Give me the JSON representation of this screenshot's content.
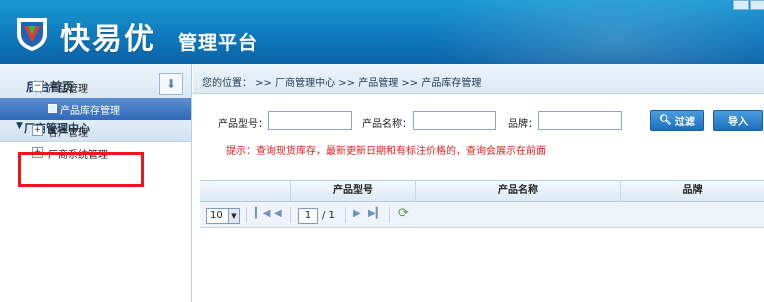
{
  "header": {
    "brand": "快易优",
    "platform": "管理平台"
  },
  "sidebar": {
    "home": "后台首页",
    "pin_icon": "pin-icon",
    "group": "厂商管理中心",
    "items": [
      {
        "label": "产品管理"
      },
      {
        "label": "产品库存管理",
        "selected": true
      },
      {
        "label": "客户管理"
      },
      {
        "label": "厂商系统管理"
      }
    ]
  },
  "breadcrumb": "您的位置： >> 厂商管理中心 >> 产品管理 >> 产品库存管理",
  "filter": {
    "model_label": "产品型号：",
    "name_label": "产品名称：",
    "brand_label": "品牌：",
    "model_value": "",
    "name_value": "",
    "brand_value": "",
    "filter_button": "过滤",
    "import_button": "导入",
    "tip": "提示：查询现货库存，最新更新日期和有标注价格的，查询会展示在前面"
  },
  "grid": {
    "columns": [
      "产品型号",
      "产品名称",
      "品牌"
    ]
  },
  "pager": {
    "page_size": "10",
    "current_page": "1",
    "total": "/ 1"
  },
  "colors": {
    "header": "#0e79bd",
    "highlight": "#e8191e",
    "tip": "#e02020",
    "button": "#1c6fbf"
  }
}
